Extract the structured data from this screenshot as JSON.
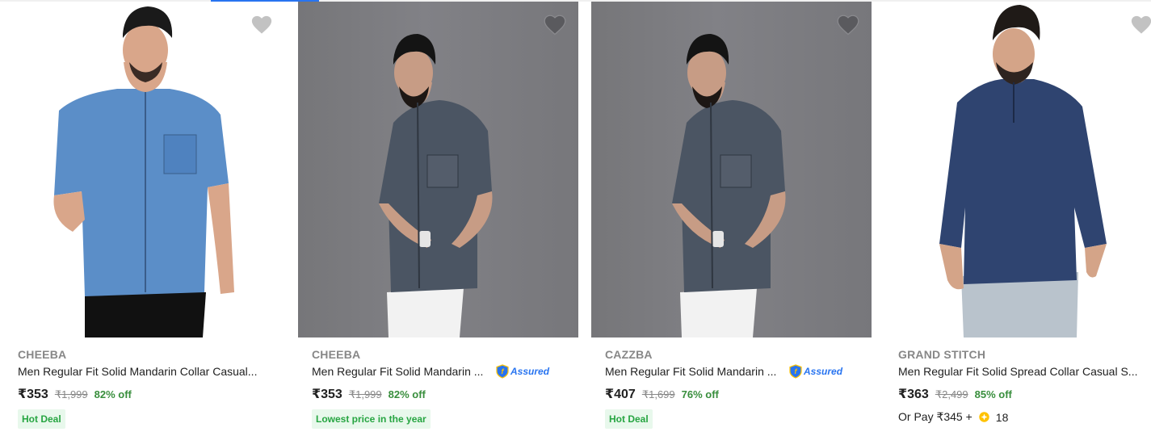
{
  "products": [
    {
      "brand": "CHEEBA",
      "title": "Men Regular Fit Solid Mandarin Collar Casual...",
      "assured": false,
      "price": "₹353",
      "mrp": "₹1,999",
      "discount": "82% off",
      "badge": "Hot Deal",
      "image_desc": "light blue denim shirt"
    },
    {
      "brand": "CHEEBA",
      "title": "Men Regular Fit Solid Mandarin ...",
      "assured": true,
      "assured_label": "Assured",
      "price": "₹353",
      "mrp": "₹1,999",
      "discount": "82% off",
      "badge": "Lowest price in the year",
      "image_desc": "washed grey denim shirt"
    },
    {
      "brand": "CAZZBA",
      "title": "Men Regular Fit Solid Mandarin ...",
      "assured": true,
      "assured_label": "Assured",
      "price": "₹407",
      "mrp": "₹1,699",
      "discount": "76% off",
      "badge": "Hot Deal",
      "image_desc": "washed grey denim shirt"
    },
    {
      "brand": "GRAND STITCH",
      "title": "Men Regular Fit Solid Spread Collar Casual S...",
      "assured": false,
      "price": "₹363",
      "mrp": "₹2,499",
      "discount": "85% off",
      "or_pay": "Or Pay ₹345 +",
      "coins": "18",
      "image_desc": "dark navy denim shirt"
    }
  ],
  "colors": {
    "accent": "#2874f0",
    "discount": "#388e3c",
    "badge_text": "#26a541",
    "badge_bg": "#e8f8ec",
    "muted": "#878787",
    "heart": "#c2c2c2",
    "coin": "#ffc200"
  },
  "icons": {
    "wishlist": "heart-icon",
    "assured": "shield-icon",
    "coin": "supercoin-icon"
  }
}
